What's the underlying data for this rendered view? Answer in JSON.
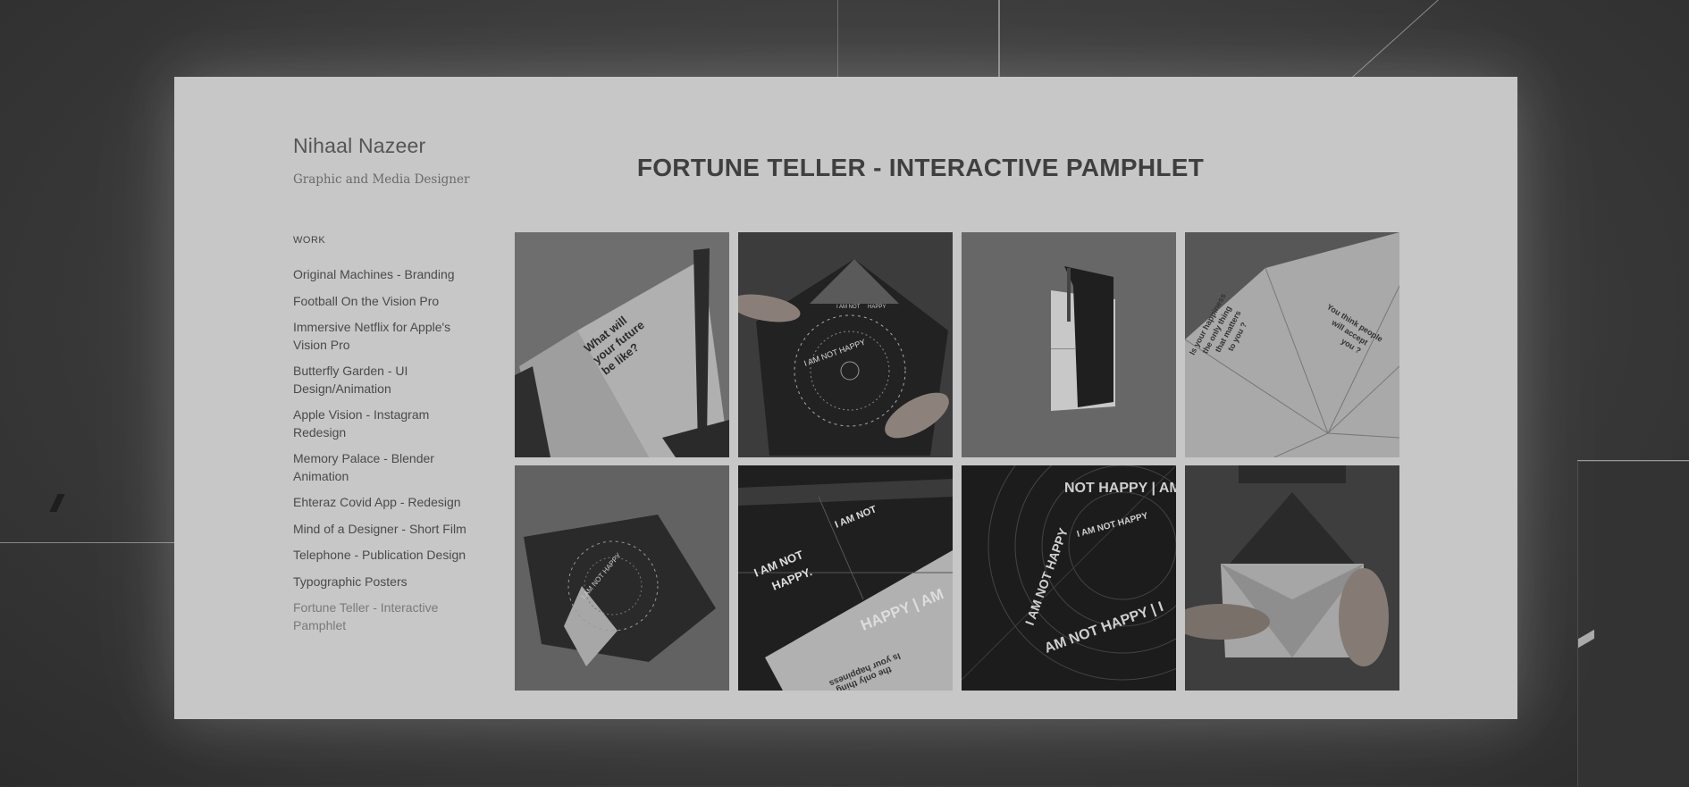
{
  "site": {
    "name": "Nihaal Nazeer",
    "tagline": "Graphic and Media Designer"
  },
  "sidebar": {
    "section_label": "WORK",
    "items": [
      {
        "label": "Original Machines - Branding"
      },
      {
        "label": "Football On the Vision Pro"
      },
      {
        "label": "Immersive Netflix for Apple's Vision Pro"
      },
      {
        "label": "Butterfly Garden - UI Design/Animation"
      },
      {
        "label": "Apple Vision - Instagram Redesign"
      },
      {
        "label": "Memory Palace - Blender Animation"
      },
      {
        "label": "Ehteraz Covid App - Redesign"
      },
      {
        "label": "Mind of a Designer - Short Film"
      },
      {
        "label": "Telephone - Publication Design"
      },
      {
        "label": "Typographic Posters"
      },
      {
        "label": "Fortune Teller - Interactive Pamphlet",
        "active": true
      }
    ]
  },
  "main": {
    "title": "FORTUNE TELLER - INTERACTIVE PAMPHLET"
  },
  "gallery": {
    "tile1": {
      "text": [
        "What will",
        "your future",
        "be like?"
      ]
    },
    "tile2": {
      "text": [
        "I AM NOT HAPPY",
        "I AM NOT",
        "HAPPY"
      ]
    },
    "tile4": {
      "text": [
        "You think people",
        "will accept",
        "you ?",
        "Is your happiness",
        "the only thing",
        "that matters",
        "to you ?"
      ]
    },
    "tile5": {
      "text": [
        "I AM NOT HAPPY"
      ]
    },
    "tile6": {
      "text": [
        "I AM NOT",
        "HAPPY.",
        "HAPPY | AM",
        "Is your happiness",
        "the only thing"
      ]
    },
    "tile7": {
      "text": [
        "NOT HAPPY | AM NOT HAPPY",
        "I AM NOT HAPPY",
        "AM NOT HAPPY | I"
      ]
    }
  },
  "colors": {
    "window_bg": "#c7c7c7",
    "backdrop": "#3a3a3a",
    "title_text": "#3f3f3f",
    "nav_text": "#4a4a4a",
    "nav_active": "#7a7a7a"
  }
}
